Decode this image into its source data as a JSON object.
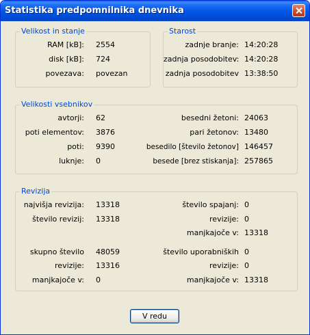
{
  "window": {
    "title": "Statistika predpomnilnika dnevnika"
  },
  "size_state": {
    "legend": "Velikost in stanje",
    "rows": [
      {
        "label": "RAM [kB]:",
        "value": "2554"
      },
      {
        "label": "disk [kB]:",
        "value": "724"
      },
      {
        "label": "povezava:",
        "value": "povezan"
      }
    ]
  },
  "age": {
    "legend": "Starost",
    "rows": [
      {
        "label": "zadnje branje:",
        "value": "14:20:28"
      },
      {
        "label": "zadnja posodobitev:",
        "value": "14:20:28"
      },
      {
        "label": "zadnja posodobitev",
        "value": "13:38:50"
      }
    ]
  },
  "container_sizes": {
    "legend": "Velikosti vsebnikov",
    "left_rows": [
      {
        "label": "avtorji:",
        "value": "62"
      },
      {
        "label": "poti elementov:",
        "value": "3876"
      },
      {
        "label": "poti:",
        "value": "9390"
      },
      {
        "label": "luknje:",
        "value": "0"
      }
    ],
    "right_rows": [
      {
        "label": "besedni žetoni:",
        "value": "24063"
      },
      {
        "label": "pari žetonov:",
        "value": "13480"
      },
      {
        "label": "besedilo [število žetonov]",
        "value": "146457"
      },
      {
        "label": "besede [brez stiskanja]:",
        "value": "257865"
      }
    ]
  },
  "revision": {
    "legend": "Revizija",
    "left_rows": [
      {
        "label": "najvišja revizija:",
        "value": "13318"
      },
      {
        "label": "število revizij:",
        "value": "13318"
      },
      {
        "label": "skupno število",
        "value": "48059"
      },
      {
        "label": "revizije:",
        "value": "13316"
      },
      {
        "label": "manjkajoče v:",
        "value": "0"
      }
    ],
    "right_rows": [
      {
        "label": "število spajanj:",
        "value": "0"
      },
      {
        "label": "revizije:",
        "value": "0"
      },
      {
        "label": "manjkajoče v:",
        "value": "13318"
      },
      {
        "label": "število uporabniških",
        "value": "0"
      },
      {
        "label": "revizije:",
        "value": "0"
      },
      {
        "label": "manjkajoče v:",
        "value": "13318"
      }
    ]
  },
  "buttons": {
    "ok": "V redu"
  }
}
